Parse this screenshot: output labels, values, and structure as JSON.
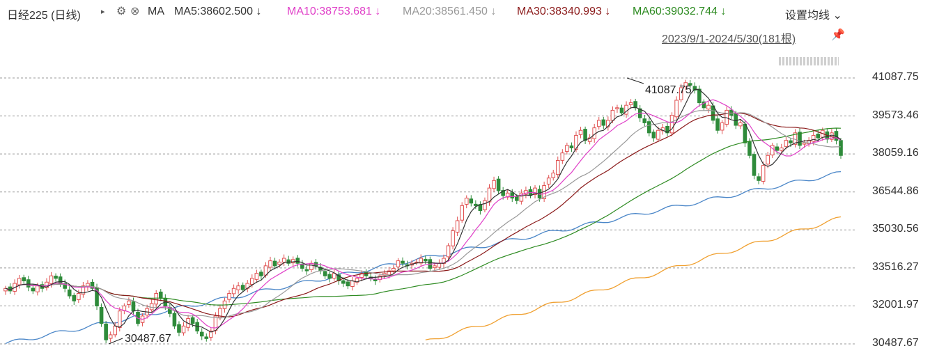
{
  "header": {
    "title": "日经225 (日线)",
    "ma_label": "MA",
    "settings_label": "设置均线",
    "date_range": "2023/9/1-2024/5/30(181根)",
    "ma_items": [
      {
        "text": "MA5:38602.500",
        "arrow": "↓",
        "color": "#333333"
      },
      {
        "text": "MA10:38753.681",
        "arrow": "↓",
        "color": "#e040c8"
      },
      {
        "text": "MA20:38561.450",
        "arrow": "↓",
        "color": "#999999"
      },
      {
        "text": "MA30:38340.993",
        "arrow": "↓",
        "color": "#8b1a1a"
      },
      {
        "text": "MA60:39032.744",
        "arrow": "↓",
        "color": "#2e8b22"
      }
    ]
  },
  "chart_data": {
    "type": "candlestick",
    "title": "日经225 (日线)",
    "y_ticks": [
      "41087.75",
      "39573.46",
      "38059.16",
      "36544.86",
      "35030.56",
      "33516.27",
      "32001.97",
      "30487.67"
    ],
    "ylim": [
      30487.67,
      41087.75
    ],
    "high_annotation": "41087.75",
    "low_annotation": "30487.67",
    "grid": true,
    "colors": {
      "up": "#e05050",
      "down": "#2e8b3a",
      "ma5": "#333333",
      "ma10": "#e040c8",
      "ma20": "#999999",
      "ma30": "#8b1a1a",
      "ma60": "#2e8b22",
      "ma120": "#4a86c8",
      "ma250": "#f0a030"
    },
    "closes": [
      32700,
      32600,
      32900,
      33100,
      33000,
      32750,
      32600,
      32800,
      32700,
      32950,
      33200,
      33100,
      32900,
      32700,
      32400,
      32200,
      32500,
      32800,
      32900,
      32700,
      32000,
      31300,
      30650,
      30850,
      31200,
      31800,
      32000,
      32200,
      31800,
      31300,
      31600,
      31900,
      32100,
      32500,
      32300,
      32000,
      31700,
      31200,
      30950,
      31200,
      31500,
      31300,
      31000,
      30800,
      30700,
      31000,
      31600,
      31900,
      32200,
      32500,
      32700,
      32800,
      32650,
      32900,
      33100,
      33300,
      33200,
      33600,
      33800,
      33600,
      33750,
      33900,
      33700,
      33850,
      33700,
      33500,
      33400,
      33700,
      33600,
      33400,
      33200,
      33100,
      33300,
      33000,
      32900,
      32800,
      33000,
      33100,
      33300,
      33200,
      33100,
      33000,
      33200,
      33300,
      33400,
      33500,
      33800,
      33700,
      33600,
      33700,
      33750,
      33900,
      33800,
      33500,
      33600,
      33700,
      33900,
      34400,
      35000,
      35400,
      36000,
      36300,
      36100,
      36000,
      35800,
      36200,
      36700,
      37000,
      36600,
      36400,
      36500,
      36300,
      36200,
      36500,
      36600,
      36400,
      36700,
      36300,
      36800,
      37100,
      37300,
      37800,
      38100,
      38400,
      38300,
      38800,
      39000,
      38600,
      38700,
      39100,
      39400,
      39200,
      39400,
      39800,
      39900,
      39700,
      40000,
      40100,
      39900,
      39500,
      39300,
      38900,
      38700,
      39000,
      39100,
      38900,
      39600,
      40200,
      40700,
      40900,
      40800,
      40600,
      40100,
      39900,
      40000,
      39400,
      39000,
      39300,
      39800,
      39600,
      39200,
      39300,
      38500,
      38000,
      37200,
      37000,
      37600,
      38000,
      38400,
      38200,
      38300,
      38600,
      38500,
      38900,
      38400,
      38500,
      38600,
      38800,
      38700,
      39000,
      38650,
      38900,
      38600,
      38000
    ],
    "ma5_last": 38602.5,
    "ma10_last": 38753.681,
    "ma20_last": 38561.45,
    "ma30_last": 38340.993,
    "ma60_last": 39032.744
  }
}
